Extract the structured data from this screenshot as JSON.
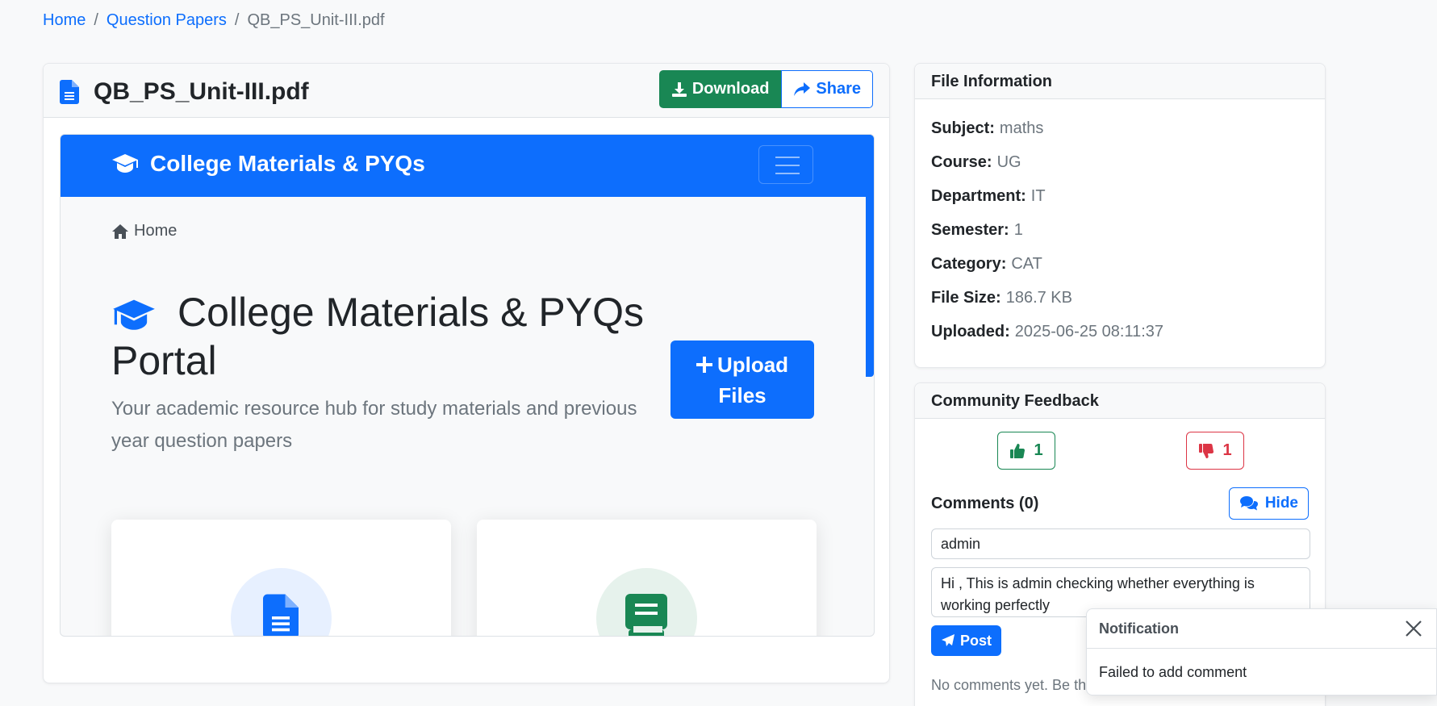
{
  "breadcrumb": {
    "home": "Home",
    "question_papers": "Question Papers",
    "current": "QB_PS_Unit-III.pdf",
    "separator": "/"
  },
  "file": {
    "name": "QB_PS_Unit-III.pdf",
    "download_label": "Download",
    "share_label": "Share"
  },
  "preview": {
    "brand": "College Materials & PYQs",
    "home_link": "Home",
    "hero_title": "College Materials & PYQs Portal",
    "hero_subtitle": "Your academic resource hub for study materials and previous year question papers",
    "upload_label": "Upload Files"
  },
  "file_info": {
    "header": "File Information",
    "rows": [
      {
        "label": "Subject:",
        "value": "maths"
      },
      {
        "label": "Course:",
        "value": "UG"
      },
      {
        "label": "Department:",
        "value": "IT"
      },
      {
        "label": "Semester:",
        "value": "1"
      },
      {
        "label": "Category:",
        "value": "CAT"
      },
      {
        "label": "File Size:",
        "value": "186.7 KB"
      },
      {
        "label": "Uploaded:",
        "value": "2025-06-25 08:11:37"
      }
    ]
  },
  "feedback": {
    "header": "Community Feedback",
    "likes": "1",
    "dislikes": "1",
    "comments_title": "Comments (0)",
    "hide_label": "Hide",
    "name_value": "admin",
    "comment_value": "Hi , This is admin checking whether everything is working perfectly",
    "post_label": "Post",
    "empty_text": "No comments yet. Be the first to comment!"
  },
  "toast": {
    "title": "Notification",
    "message": "Failed to add comment"
  },
  "colors": {
    "primary": "#0d6efd",
    "success": "#198754",
    "danger": "#dc3545"
  }
}
